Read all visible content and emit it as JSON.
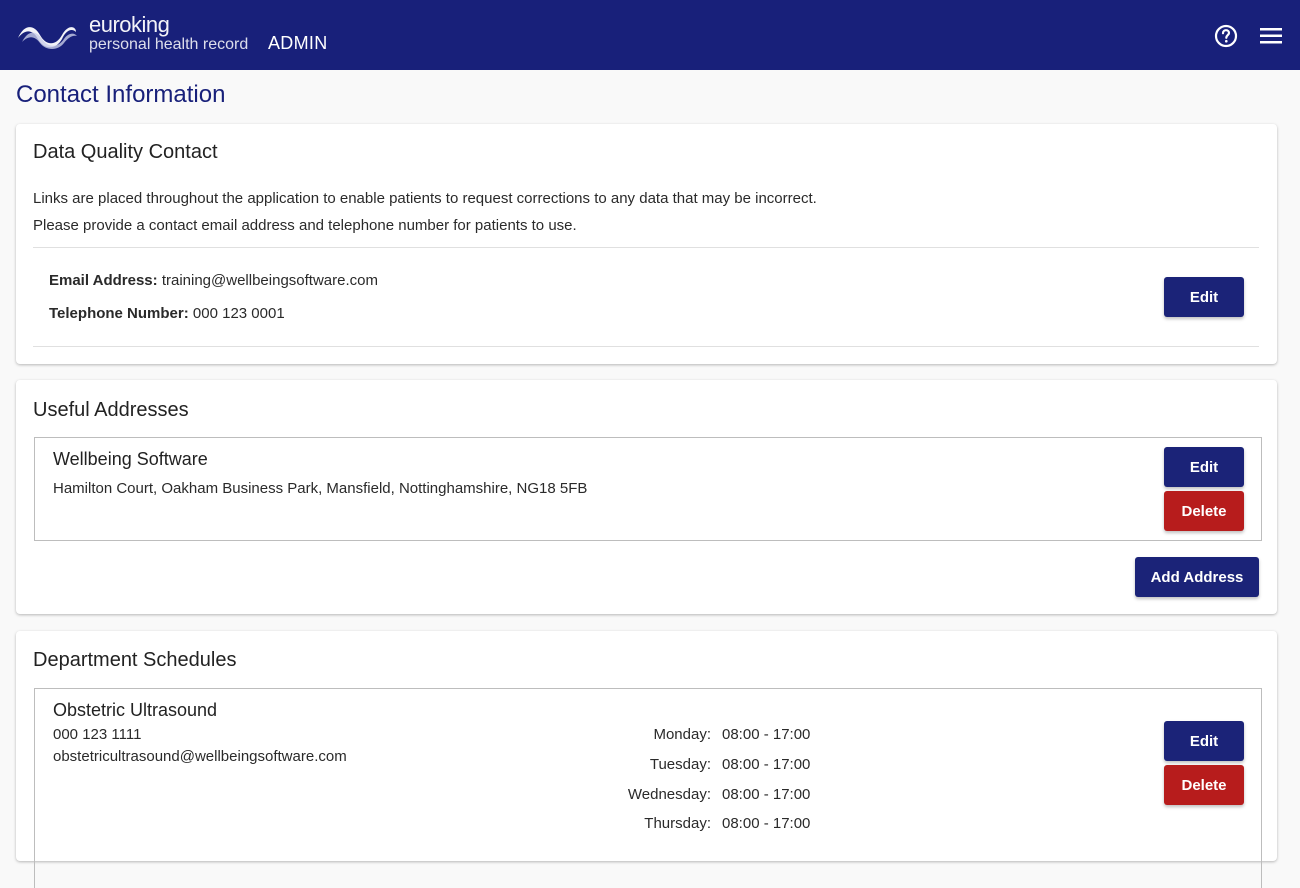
{
  "header": {
    "brand_name": "euroking",
    "brand_sub": "personal health record",
    "title": "ADMIN"
  },
  "page_title": "Contact Information",
  "data_quality": {
    "title": "Data Quality Contact",
    "line1": "Links are placed throughout the application to enable patients to request corrections to any data that may be incorrect.",
    "line2": "Please provide a contact email address and telephone number for patients to use.",
    "email_label": "Email Address:",
    "email_value": "training@wellbeingsoftware.com",
    "phone_label": "Telephone Number:",
    "phone_value": "000 123 0001",
    "edit_label": "Edit"
  },
  "useful_addresses": {
    "title": "Useful Addresses",
    "items": [
      {
        "name": "Wellbeing Software",
        "address": "Hamilton Court, Oakham Business Park, Mansfield, Nottinghamshire, NG18 5FB",
        "edit_label": "Edit",
        "delete_label": "Delete"
      }
    ],
    "add_label": "Add Address"
  },
  "department_schedules": {
    "title": "Department Schedules",
    "items": [
      {
        "name": "Obstetric Ultrasound",
        "phone": "000 123 1111",
        "email": "obstetricultrasound@wellbeingsoftware.com",
        "schedule": [
          {
            "day": "Monday:",
            "hours": "08:00 - 17:00"
          },
          {
            "day": "Tuesday:",
            "hours": "08:00 - 17:00"
          },
          {
            "day": "Wednesday:",
            "hours": "08:00 - 17:00"
          },
          {
            "day": "Thursday:",
            "hours": "08:00 - 17:00"
          }
        ],
        "edit_label": "Edit",
        "delete_label": "Delete"
      }
    ]
  },
  "colors": {
    "header": "#18207a",
    "primary": "#1b2378",
    "danger": "#b71c1c",
    "background": "#f9f9f9"
  },
  "icons": [
    "euroking-logo",
    "help-circle-icon",
    "hamburger-menu-icon"
  ]
}
